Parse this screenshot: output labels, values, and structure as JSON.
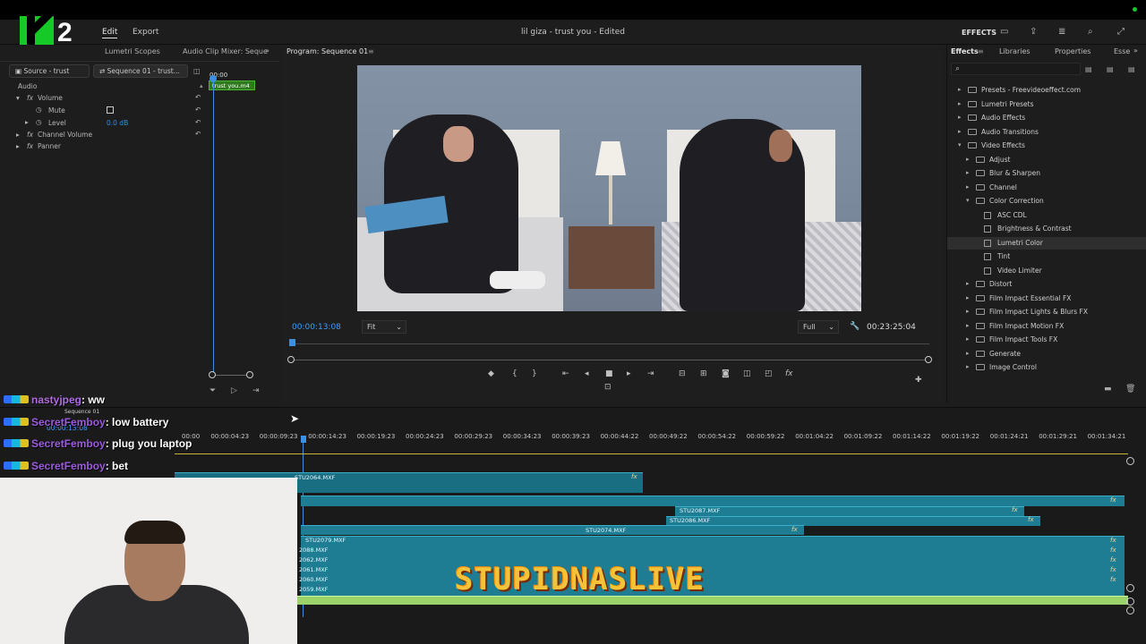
{
  "menu": {
    "edit": "Edit",
    "export": "Export"
  },
  "title": "lil giza - trust you - Edited",
  "header_right": {
    "effects": "EFFECTS"
  },
  "left_panel": {
    "tabs": [
      "Lumetri Scopes",
      "Audio Clip Mixer: Seque"
    ],
    "source_tab": "Source - trust",
    "sequence_tab": "Sequence 01 - trust...",
    "clip_label": "trust you.m4",
    "section": "Audio",
    "rows": [
      {
        "label": "Volume"
      },
      {
        "label": "Mute"
      },
      {
        "label": "Level",
        "value": "0.0 dB"
      },
      {
        "label": "Channel Volume"
      },
      {
        "label": "Panner"
      }
    ],
    "timecode_top": "00:00"
  },
  "program": {
    "tab": "Program: Sequence 01",
    "timecode_current": "00:00:13:08",
    "fit": "Fit",
    "quality": "Full",
    "timecode_duration": "00:23:25:04"
  },
  "effects_panel": {
    "tabs": [
      "Effects",
      "Libraries",
      "Properties",
      "Esse"
    ],
    "items": [
      {
        "label": "Presets - Freevideoeffect.com",
        "type": "folder",
        "depth": 0,
        "open": false
      },
      {
        "label": "Lumetri Presets",
        "type": "folder",
        "depth": 0,
        "open": false
      },
      {
        "label": "Audio Effects",
        "type": "folder",
        "depth": 0,
        "open": false
      },
      {
        "label": "Audio Transitions",
        "type": "folder",
        "depth": 0,
        "open": false
      },
      {
        "label": "Video Effects",
        "type": "folder",
        "depth": 0,
        "open": true
      },
      {
        "label": "Adjust",
        "type": "folder",
        "depth": 1,
        "open": false
      },
      {
        "label": "Blur & Sharpen",
        "type": "folder",
        "depth": 1,
        "open": false
      },
      {
        "label": "Channel",
        "type": "folder",
        "depth": 1,
        "open": false
      },
      {
        "label": "Color Correction",
        "type": "folder",
        "depth": 1,
        "open": true
      },
      {
        "label": "ASC CDL",
        "type": "fx",
        "depth": 2
      },
      {
        "label": "Brightness & Contrast",
        "type": "fx",
        "depth": 2
      },
      {
        "label": "Lumetri Color",
        "type": "fx",
        "depth": 2,
        "selected": true
      },
      {
        "label": "Tint",
        "type": "fx",
        "depth": 2
      },
      {
        "label": "Video Limiter",
        "type": "fx",
        "depth": 2
      },
      {
        "label": "Distort",
        "type": "folder",
        "depth": 1,
        "open": false
      },
      {
        "label": "Film Impact Essential FX",
        "type": "folder",
        "depth": 1,
        "open": false
      },
      {
        "label": "Film Impact Lights & Blurs FX",
        "type": "folder",
        "depth": 1,
        "open": false
      },
      {
        "label": "Film Impact Motion FX",
        "type": "folder",
        "depth": 1,
        "open": false
      },
      {
        "label": "Film Impact Tools FX",
        "type": "folder",
        "depth": 1,
        "open": false
      },
      {
        "label": "Generate",
        "type": "folder",
        "depth": 1,
        "open": false
      },
      {
        "label": "Image Control",
        "type": "folder",
        "depth": 1,
        "open": false
      }
    ]
  },
  "timeline": {
    "tab": "Sequence 01",
    "timecode": "00:00:13:08",
    "ruler": [
      "00:00",
      "00:00:04:23",
      "00:00:09:23",
      "00:00:14:23",
      "00:00:19:23",
      "00:00:24:23",
      "00:00:29:23",
      "00:00:34:23",
      "00:00:39:23",
      "00:00:44:22",
      "00:00:49:22",
      "00:00:54:22",
      "00:00:59:22",
      "00:01:04:22",
      "00:01:09:22",
      "00:01:14:22",
      "00:01:19:22",
      "00:01:24:21",
      "00:01:29:21",
      "00:01:34:21"
    ],
    "clips": {
      "c1": "STU2064.MXF",
      "c2": "STU2087.MXF",
      "c3": "STU2086.MXF",
      "c4": "STU2074.MXF",
      "c5": "STU2079.MXF",
      "s1": "2088.MXF",
      "s2": "2062.MXF",
      "s3": "2061.MXF",
      "s4": "2060.MXF",
      "s5": "2059.MXF"
    },
    "fx": "fx"
  },
  "chat": [
    {
      "user": "nastyjpeg",
      "message": ": ww"
    },
    {
      "user": "SecretFemboy",
      "message": ": low battery"
    },
    {
      "user": "SecretFemboy",
      "message": ": plug you laptop"
    },
    {
      "user": "SecretFemboy",
      "message": ": bet"
    }
  ],
  "branding": {
    "logo_number": "2",
    "overlay": "STUPIDNASLIVE"
  },
  "colors": {
    "accent": "#2d8ceb",
    "clip": "#1f7d93",
    "audio": "#9bd36a",
    "logo": "#15c926"
  }
}
